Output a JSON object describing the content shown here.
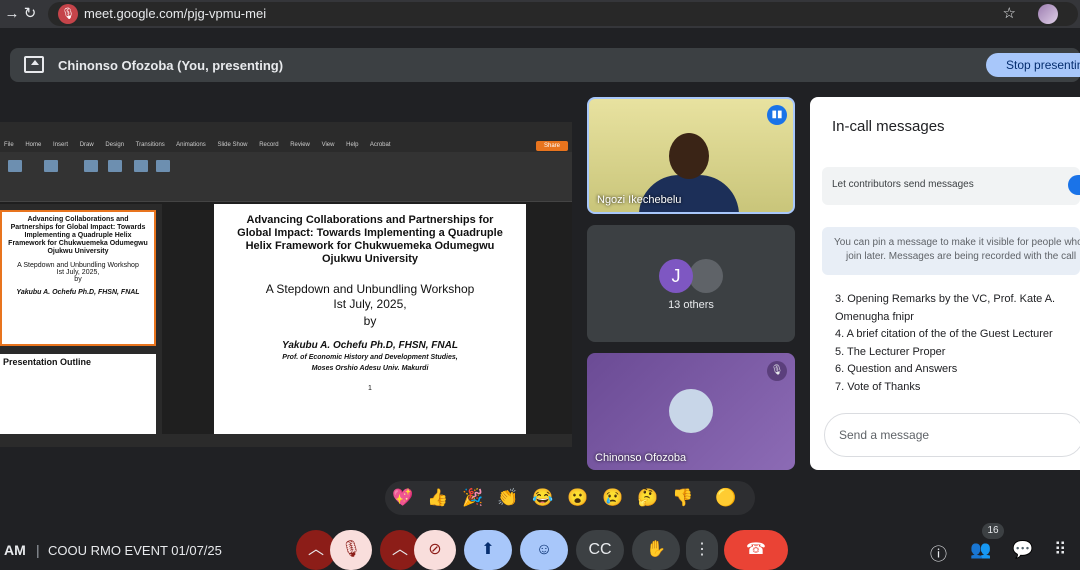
{
  "browser": {
    "url": "meet.google.com/pjg-vpmu-mei"
  },
  "presenting_bar": {
    "text": "Chinonso Ofozoba (You, presenting)",
    "stop_label": "Stop presenting"
  },
  "slide": {
    "title": "Advancing Collaborations and Partnerships for Global Impact: Towards Implementing a  Quadruple Helix Framework for Chukwuemeka Odumegwu Ojukwu University",
    "workshop": "A Stepdown and Unbundling Workshop",
    "date": "Ist July, 2025,",
    "by": "by",
    "author": "Yakubu A. Ochefu Ph.D, FHSN, FNAL",
    "affiliation_1": "Prof. of Economic History and Development Studies,",
    "affiliation_2": "Moses Orshio Adesu Univ.  Makurdi",
    "page_number": "1",
    "thumb2_title": "Presentation Outline",
    "ribbon_tabs": [
      "File",
      "Home",
      "Insert",
      "Draw",
      "Design",
      "Transitions",
      "Animations",
      "Slide Show",
      "Record",
      "Review",
      "View",
      "Help",
      "Acrobat"
    ],
    "share_label": "Share"
  },
  "participants": {
    "tile1_name": "Ngozi Ikechebelu",
    "others_initial": "J",
    "others_label": "13 others",
    "tile3_name": "Chinonso Ofozoba"
  },
  "chat": {
    "title": "In-call messages",
    "toggle_label": "Let contributors send messages",
    "info_line1": "You can pin a message to make it visible for people who",
    "info_line2": "join later. Messages are being recorded with the call",
    "agenda": [
      "3. Opening Remarks by the VC, Prof. Kate A.",
      "Omenugha fnipr",
      "4. A brief citation of the of the Guest Lecturer",
      "5. The Lecturer Proper",
      "6. Question and Answers",
      "7. Vote of Thanks"
    ],
    "input_placeholder": "Send a message"
  },
  "reactions": [
    "💖",
    "👍",
    "🎉",
    "👏",
    "😂",
    "😮",
    "😢",
    "🤔",
    "👎",
    "🟡"
  ],
  "bottom_bar": {
    "time": "AM",
    "separator": "|",
    "meeting_name": "COOU RMO EVENT 01/07/25",
    "participant_count": "16"
  },
  "colors": {
    "accent_blue": "#a8c7fa",
    "end_call_red": "#ea4335",
    "muted_red": "#8c1d18",
    "powerpoint_orange": "#e8741e"
  },
  "icons": {
    "mic_muted": "mic-off-icon",
    "cam_off": "videocam-off-icon",
    "present": "present-to-all-icon",
    "reactions": "emoji-icon",
    "captions": "closed-caption-icon",
    "raise_hand": "hand-icon",
    "more": "more-vert-icon",
    "end_call": "call-end-icon",
    "info": "info-icon",
    "people": "people-icon",
    "chat": "chat-icon",
    "activities": "apps-icon"
  }
}
